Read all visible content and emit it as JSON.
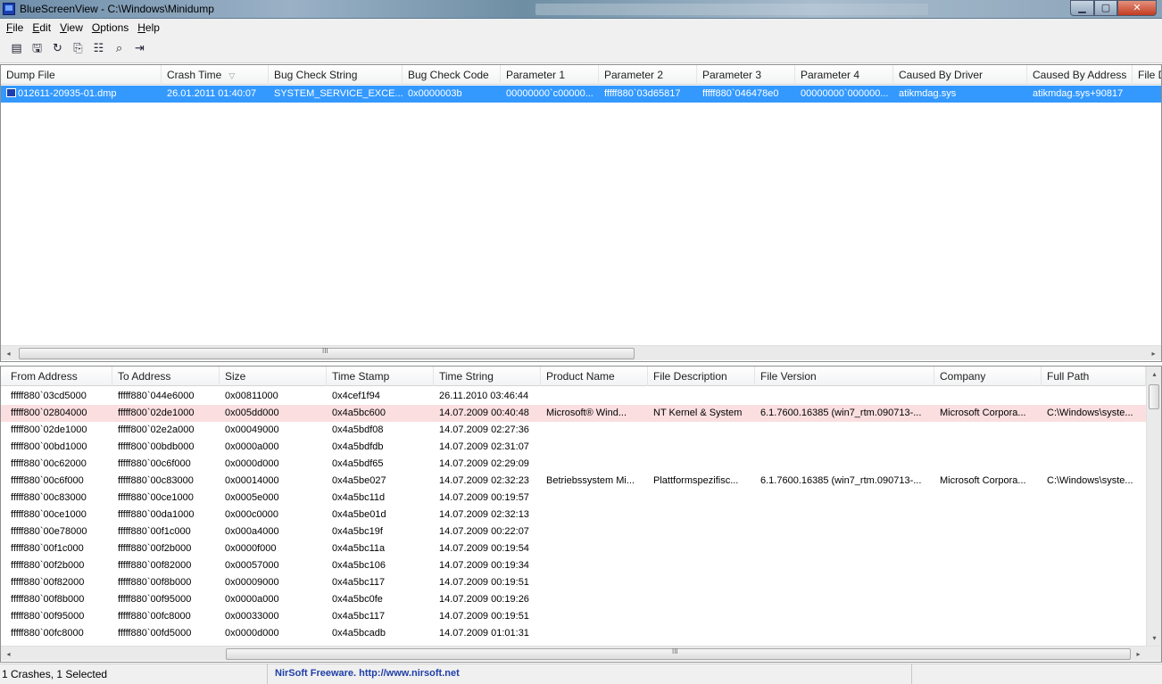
{
  "window": {
    "title": "BlueScreenView  -  C:\\Windows\\Minidump",
    "min_glyph": "▁",
    "max_glyph": "▢",
    "close_glyph": "✕"
  },
  "menu": [
    "File",
    "Edit",
    "View",
    "Options",
    "Help"
  ],
  "toolbar_icons": [
    "properties-icon",
    "save-icon",
    "refresh-icon",
    "copy-icon",
    "html-report-icon",
    "find-icon",
    "exit-icon"
  ],
  "upper_list": {
    "columns": [
      "Dump File",
      "Crash Time",
      "Bug Check String",
      "Bug Check Code",
      "Parameter 1",
      "Parameter 2",
      "Parameter 3",
      "Parameter 4",
      "Caused By Driver",
      "Caused By Address",
      "File D"
    ],
    "sort_glyph": "▽",
    "rows": [
      [
        "012611-20935-01.dmp",
        "26.01.2011 01:40:07",
        "SYSTEM_SERVICE_EXCE...",
        "0x0000003b",
        "00000000`c00000...",
        "fffff880`03d65817",
        "fffff880`046478e0",
        "00000000`000000...",
        "atikmdag.sys",
        "atikmdag.sys+90817",
        ""
      ]
    ]
  },
  "lower_list": {
    "columns": [
      "From Address",
      "To Address",
      "Size",
      "Time Stamp",
      "Time String",
      "Product Name",
      "File Description",
      "File Version",
      "Company",
      "Full Path"
    ],
    "rows": [
      [
        "fffff880`03cd5000",
        "fffff880`044e6000",
        "0x00811000",
        "0x4cef1f94",
        "26.11.2010 03:46:44",
        "",
        "",
        "",
        "",
        ""
      ],
      [
        "fffff800`02804000",
        "fffff800`02de1000",
        "0x005dd000",
        "0x4a5bc600",
        "14.07.2009 00:40:48",
        "Microsoft® Wind...",
        "NT Kernel & System",
        "6.1.7600.16385 (win7_rtm.090713-...",
        "Microsoft Corpora...",
        "C:\\Windows\\syste..."
      ],
      [
        "fffff800`02de1000",
        "fffff800`02e2a000",
        "0x00049000",
        "0x4a5bdf08",
        "14.07.2009 02:27:36",
        "",
        "",
        "",
        "",
        ""
      ],
      [
        "fffff800`00bd1000",
        "fffff800`00bdb000",
        "0x0000a000",
        "0x4a5bdfdb",
        "14.07.2009 02:31:07",
        "",
        "",
        "",
        "",
        ""
      ],
      [
        "fffff880`00c62000",
        "fffff880`00c6f000",
        "0x0000d000",
        "0x4a5bdf65",
        "14.07.2009 02:29:09",
        "",
        "",
        "",
        "",
        ""
      ],
      [
        "fffff880`00c6f000",
        "fffff880`00c83000",
        "0x00014000",
        "0x4a5be027",
        "14.07.2009 02:32:23",
        "Betriebssystem Mi...",
        "Plattformspezifisc...",
        "6.1.7600.16385 (win7_rtm.090713-...",
        "Microsoft Corpora...",
        "C:\\Windows\\syste..."
      ],
      [
        "fffff880`00c83000",
        "fffff880`00ce1000",
        "0x0005e000",
        "0x4a5bc11d",
        "14.07.2009 00:19:57",
        "",
        "",
        "",
        "",
        ""
      ],
      [
        "fffff880`00ce1000",
        "fffff880`00da1000",
        "0x000c0000",
        "0x4a5be01d",
        "14.07.2009 02:32:13",
        "",
        "",
        "",
        "",
        ""
      ],
      [
        "fffff880`00e78000",
        "fffff880`00f1c000",
        "0x000a4000",
        "0x4a5bc19f",
        "14.07.2009 00:22:07",
        "",
        "",
        "",
        "",
        ""
      ],
      [
        "fffff880`00f1c000",
        "fffff880`00f2b000",
        "0x0000f000",
        "0x4a5bc11a",
        "14.07.2009 00:19:54",
        "",
        "",
        "",
        "",
        ""
      ],
      [
        "fffff880`00f2b000",
        "fffff880`00f82000",
        "0x00057000",
        "0x4a5bc106",
        "14.07.2009 00:19:34",
        "",
        "",
        "",
        "",
        ""
      ],
      [
        "fffff880`00f82000",
        "fffff880`00f8b000",
        "0x00009000",
        "0x4a5bc117",
        "14.07.2009 00:19:51",
        "",
        "",
        "",
        "",
        ""
      ],
      [
        "fffff880`00f8b000",
        "fffff880`00f95000",
        "0x0000a000",
        "0x4a5bc0fe",
        "14.07.2009 00:19:26",
        "",
        "",
        "",
        "",
        ""
      ],
      [
        "fffff880`00f95000",
        "fffff880`00fc8000",
        "0x00033000",
        "0x4a5bc117",
        "14.07.2009 00:19:51",
        "",
        "",
        "",
        "",
        ""
      ],
      [
        "fffff880`00fc8000",
        "fffff880`00fd5000",
        "0x0000d000",
        "0x4a5bcadb",
        "14.07.2009 01:01:31",
        "",
        "",
        "",
        "",
        ""
      ]
    ],
    "highlighted_row": 1
  },
  "scroll": {
    "left": "◂",
    "right": "▸",
    "up": "▴",
    "down": "▾",
    "grip": "III"
  },
  "status": {
    "count": "1 Crashes, 1 Selected",
    "credit": "NirSoft Freeware.  http://www.nirsoft.net"
  }
}
